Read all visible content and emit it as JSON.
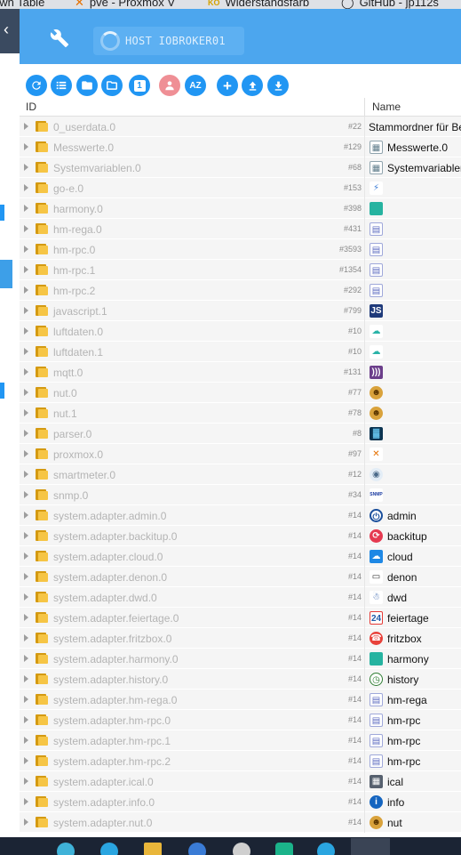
{
  "browser_tabs": [
    {
      "label": "own Table",
      "favicon": ""
    },
    {
      "label": "pve - Proxmox V",
      "favicon": "proxmox-icon"
    },
    {
      "label": "Widerstandsfarb",
      "favicon": "ko-icon"
    },
    {
      "label": "GitHub - jp112s",
      "favicon": "github-icon"
    }
  ],
  "app": {
    "host_label": "HOST IOBROKER01",
    "colors": {
      "appbar": "#4ca6ee",
      "accent": "#2196f3"
    }
  },
  "toolbar": {
    "buttons": [
      {
        "name": "refresh-button",
        "icon": "refresh-icon"
      },
      {
        "name": "list-view-button",
        "icon": "list-icon"
      },
      {
        "name": "folder-button",
        "icon": "folder-icon"
      },
      {
        "name": "folder-outline-button",
        "icon": "folder-outline-icon"
      },
      {
        "name": "counter-button",
        "icon": "numeric-1-icon",
        "text": "1"
      },
      {
        "name": "user-button",
        "icon": "user-icon"
      },
      {
        "name": "sort-az-button",
        "icon": "sort-az-icon",
        "text": "AZ"
      },
      {
        "name": "add-button",
        "icon": "plus-icon",
        "text": "+"
      },
      {
        "name": "upload-button",
        "icon": "upload-icon"
      },
      {
        "name": "download-button",
        "icon": "download-icon"
      }
    ]
  },
  "table": {
    "col_id": "ID",
    "col_name": "Name",
    "rows": [
      {
        "id": "0_userdata.0",
        "count": "#22",
        "name": "Stammordner für Be",
        "icon": "none"
      },
      {
        "id": "Messwerte.0",
        "count": "#129",
        "name": "Messwerte.0",
        "icon": "grid-icon"
      },
      {
        "id": "Systemvariablen.0",
        "count": "#68",
        "name": "Systemvariablen",
        "icon": "grid-icon"
      },
      {
        "id": "go-e.0",
        "count": "#153",
        "name": "",
        "icon": "go-e-icon"
      },
      {
        "id": "harmony.0",
        "count": "#398",
        "name": "",
        "icon": "harmony-icon"
      },
      {
        "id": "hm-rega.0",
        "count": "#431",
        "name": "",
        "icon": "homematic-icon"
      },
      {
        "id": "hm-rpc.0",
        "count": "#3593",
        "name": "",
        "icon": "homematic-icon"
      },
      {
        "id": "hm-rpc.1",
        "count": "#1354",
        "name": "",
        "icon": "homematic-icon"
      },
      {
        "id": "hm-rpc.2",
        "count": "#292",
        "name": "",
        "icon": "homematic-icon"
      },
      {
        "id": "javascript.1",
        "count": "#799",
        "name": "",
        "icon": "javascript-icon"
      },
      {
        "id": "luftdaten.0",
        "count": "#10",
        "name": "",
        "icon": "luftdaten-icon"
      },
      {
        "id": "luftdaten.1",
        "count": "#10",
        "name": "",
        "icon": "luftdaten-icon"
      },
      {
        "id": "mqtt.0",
        "count": "#131",
        "name": "",
        "icon": "mqtt-icon"
      },
      {
        "id": "nut.0",
        "count": "#77",
        "name": "",
        "icon": "nut-icon"
      },
      {
        "id": "nut.1",
        "count": "#78",
        "name": "",
        "icon": "nut-icon"
      },
      {
        "id": "parser.0",
        "count": "#8",
        "name": "",
        "icon": "parser-icon"
      },
      {
        "id": "proxmox.0",
        "count": "#97",
        "name": "",
        "icon": "proxmox-icon"
      },
      {
        "id": "smartmeter.0",
        "count": "#12",
        "name": "",
        "icon": "smartmeter-icon"
      },
      {
        "id": "snmp.0",
        "count": "#34",
        "name": "",
        "icon": "snmp-icon"
      },
      {
        "id": "system.adapter.admin.0",
        "count": "#14",
        "name": "admin",
        "icon": "admin-icon"
      },
      {
        "id": "system.adapter.backitup.0",
        "count": "#14",
        "name": "backitup",
        "icon": "backitup-icon"
      },
      {
        "id": "system.adapter.cloud.0",
        "count": "#14",
        "name": "cloud",
        "icon": "cloud-icon"
      },
      {
        "id": "system.adapter.denon.0",
        "count": "#14",
        "name": "denon",
        "icon": "denon-icon"
      },
      {
        "id": "system.adapter.dwd.0",
        "count": "#14",
        "name": "dwd",
        "icon": "dwd-icon"
      },
      {
        "id": "system.adapter.feiertage.0",
        "count": "#14",
        "name": "feiertage",
        "icon": "calendar-icon"
      },
      {
        "id": "system.adapter.fritzbox.0",
        "count": "#14",
        "name": "fritzbox",
        "icon": "fritzbox-icon"
      },
      {
        "id": "system.adapter.harmony.0",
        "count": "#14",
        "name": "harmony",
        "icon": "harmony-icon"
      },
      {
        "id": "system.adapter.history.0",
        "count": "#14",
        "name": "history",
        "icon": "history-icon"
      },
      {
        "id": "system.adapter.hm-rega.0",
        "count": "#14",
        "name": "hm-rega",
        "icon": "homematic-icon"
      },
      {
        "id": "system.adapter.hm-rpc.0",
        "count": "#14",
        "name": "hm-rpc",
        "icon": "homematic-icon"
      },
      {
        "id": "system.adapter.hm-rpc.1",
        "count": "#14",
        "name": "hm-rpc",
        "icon": "homematic-icon"
      },
      {
        "id": "system.adapter.hm-rpc.2",
        "count": "#14",
        "name": "hm-rpc",
        "icon": "homematic-icon"
      },
      {
        "id": "system.adapter.ical.0",
        "count": "#14",
        "name": "ical",
        "icon": "ical-icon"
      },
      {
        "id": "system.adapter.info.0",
        "count": "#14",
        "name": "info",
        "icon": "info-icon"
      },
      {
        "id": "system.adapter.nut.0",
        "count": "#14",
        "name": "nut",
        "icon": "nut-icon"
      }
    ]
  }
}
